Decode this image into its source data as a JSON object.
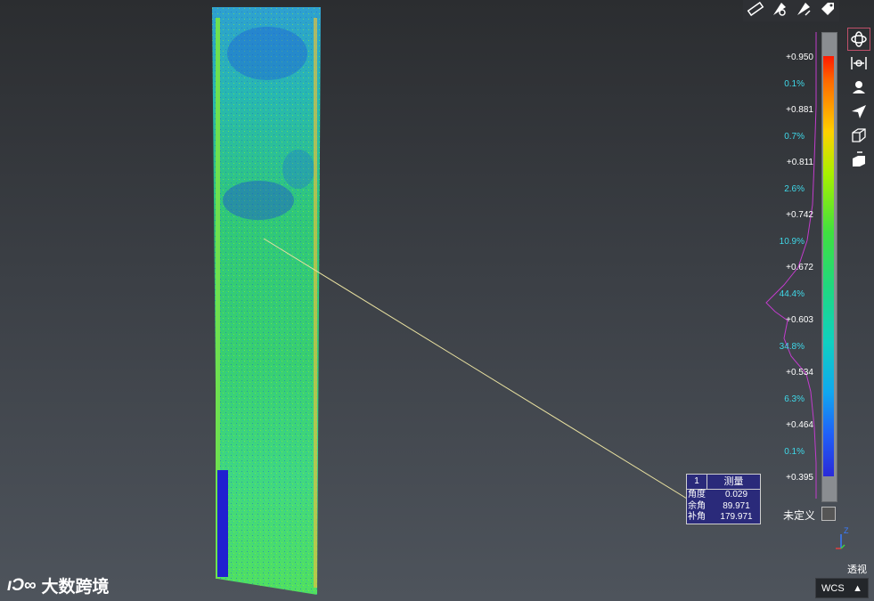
{
  "toolbar": {
    "icons": [
      "ruler-icon",
      "measure-angle-icon",
      "measure-distance-icon",
      "tag-icon"
    ]
  },
  "side_tools": [
    "orbit-icon",
    "fit-view-icon",
    "user-view-icon",
    "navigate-icon",
    "box-view-icon",
    "layers-view-icon"
  ],
  "scale": {
    "ticks": [
      "+0.950",
      "+0.881",
      "+0.811",
      "+0.742",
      "+0.672",
      "+0.603",
      "+0.534",
      "+0.464",
      "+0.395"
    ],
    "percents": [
      "0.1%",
      "0.7%",
      "2.6%",
      "10.9%",
      "44.4%",
      "34.8%",
      "6.3%",
      "0.1%"
    ],
    "undefined_label": "未定义"
  },
  "measure": {
    "index": "1",
    "title": "测量",
    "rows": [
      {
        "key": "角度",
        "value": "0.029"
      },
      {
        "key": "余角",
        "value": "89.971"
      },
      {
        "key": "补角",
        "value": "179.971"
      }
    ]
  },
  "view": {
    "perspective_label": "透视",
    "coord_system": "WCS",
    "axis_label": "Z"
  },
  "logo": {
    "mark": "ıƆ∞",
    "text": "大数跨境"
  },
  "colors": {
    "accent": "#c0506a",
    "histogram": "#c23ccc",
    "measure_line": "#e8e0a0",
    "percent_text": "#3fd8e8"
  }
}
